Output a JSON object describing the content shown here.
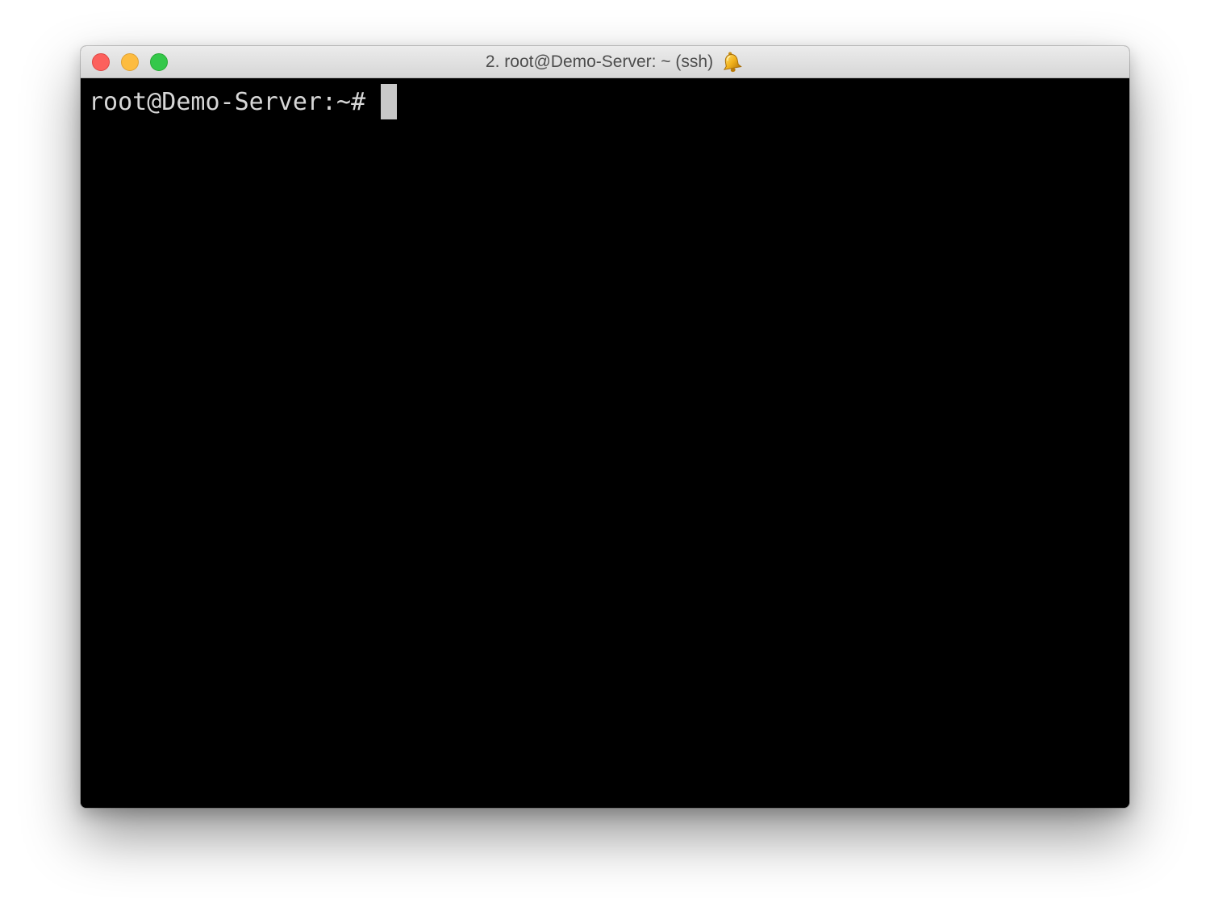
{
  "window": {
    "title": "2. root@Demo-Server: ~ (ssh)",
    "title_icon": "bell-icon"
  },
  "traffic_lights": {
    "close_color": "#fc605c",
    "minimize_color": "#fdbc40",
    "zoom_color": "#34c84a"
  },
  "terminal": {
    "prompt": "root@Demo-Server:~#",
    "background_color": "#000000",
    "text_color": "#d7d7d7"
  }
}
